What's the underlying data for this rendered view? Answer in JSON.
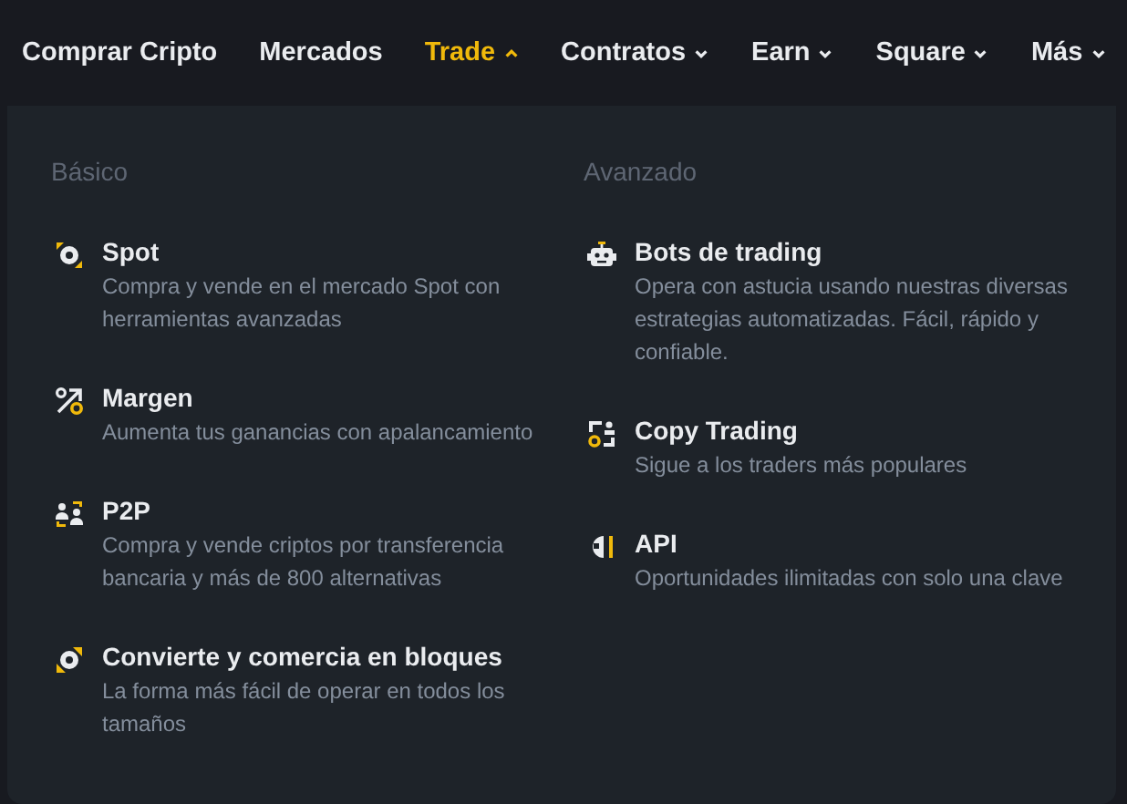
{
  "nav": [
    {
      "label": "Comprar Cripto",
      "has_menu": false,
      "selected": false
    },
    {
      "label": "Mercados",
      "has_menu": false,
      "selected": false
    },
    {
      "label": "Trade",
      "has_menu": true,
      "selected": true
    },
    {
      "label": "Contratos",
      "has_menu": true,
      "selected": false
    },
    {
      "label": "Earn",
      "has_menu": true,
      "selected": false
    },
    {
      "label": "Square",
      "has_menu": true,
      "selected": false
    },
    {
      "label": "Más",
      "has_menu": true,
      "selected": false
    }
  ],
  "menu": {
    "columns": [
      {
        "heading": "Básico",
        "items": [
          {
            "kind": "spot",
            "title": "Spot",
            "description": "Compra y vende en el mercado Spot con herramientas avanzadas"
          },
          {
            "kind": "margin",
            "title": "Margen",
            "description": "Aumenta tus ganancias con apalancamiento"
          },
          {
            "kind": "p2p",
            "title": "P2P",
            "description": "Compra y vende criptos por transferencia bancaria y más de 800 alternativas"
          },
          {
            "kind": "convert",
            "title": "Convierte y comercia en bloques",
            "description": "La forma más fácil de operar en todos los tamaños"
          }
        ]
      },
      {
        "heading": "Avanzado",
        "items": [
          {
            "kind": "bot",
            "title": "Bots de trading",
            "description": "Opera con astucia usando nuestras diversas estrategias automatizadas. Fácil, rápido y confiable."
          },
          {
            "kind": "copy",
            "title": "Copy Trading",
            "description": "Sigue a los traders más populares"
          },
          {
            "kind": "api",
            "title": "API",
            "description": "Oportunidades ilimitadas con solo una clave"
          }
        ]
      }
    ]
  }
}
